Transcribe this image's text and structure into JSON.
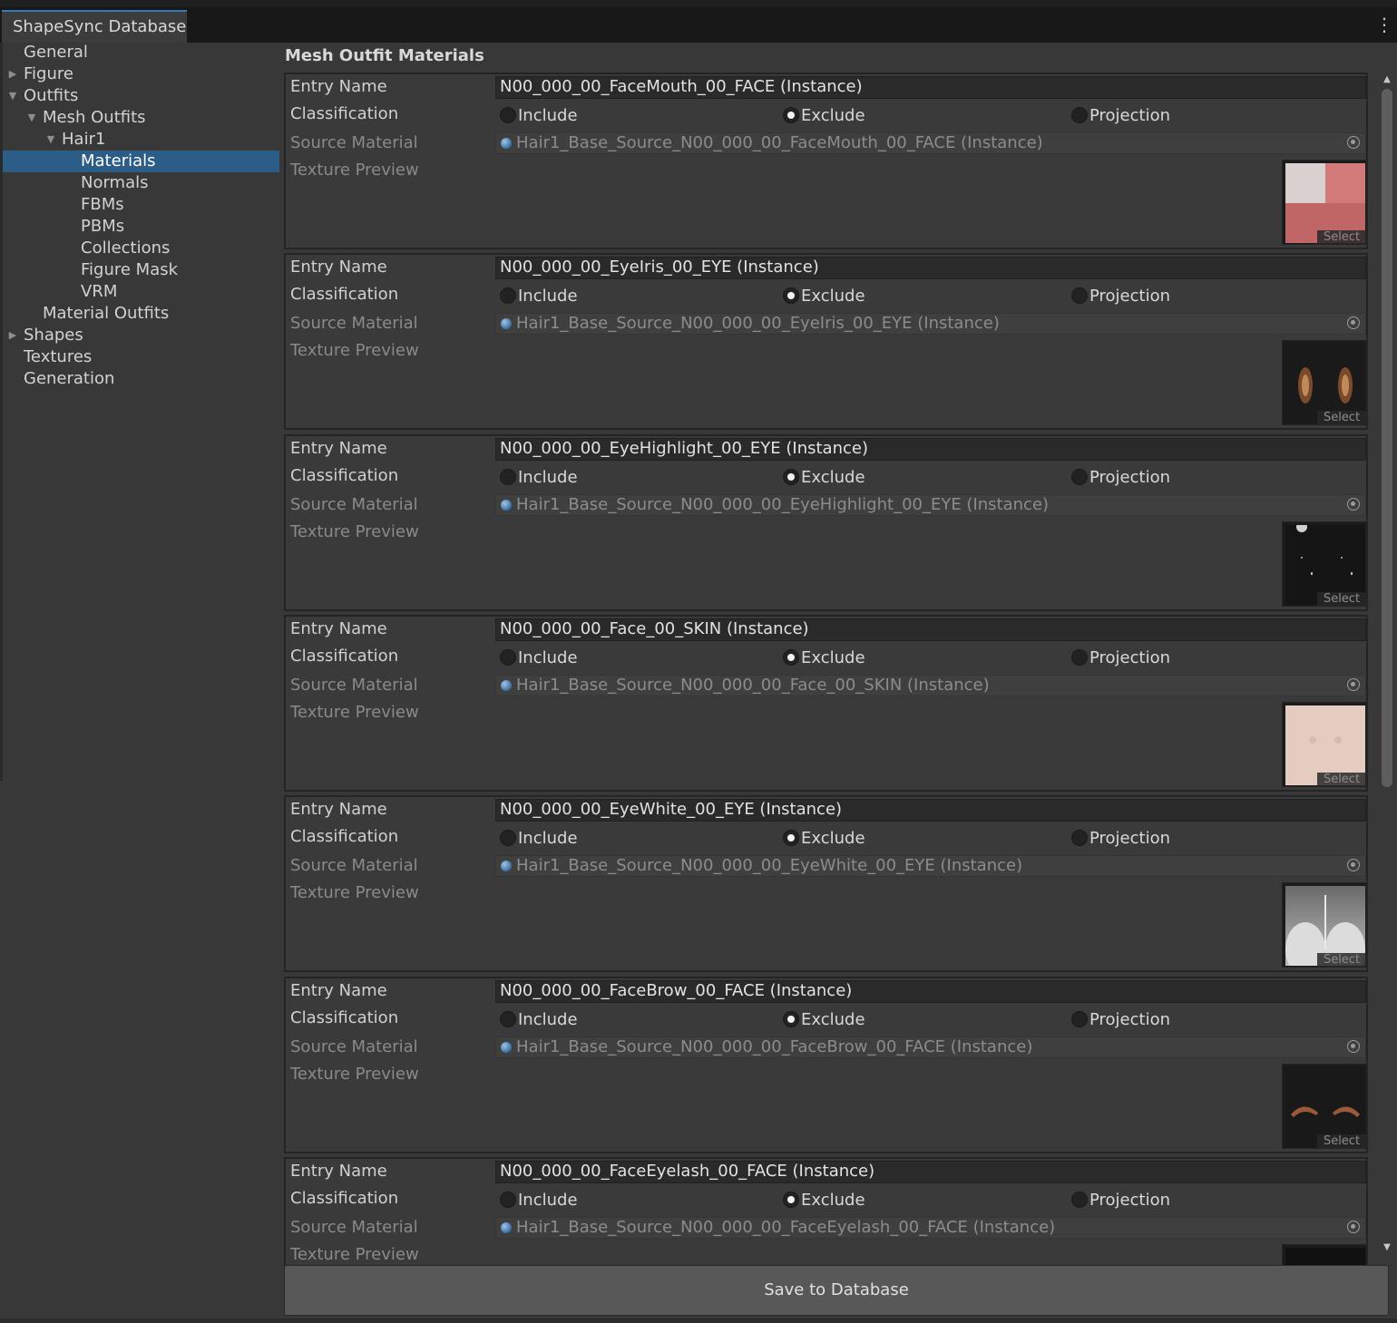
{
  "window": {
    "tab_title": "ShapeSync Database",
    "menu_glyph": "⋮"
  },
  "sidebar": {
    "items": [
      {
        "label": "General",
        "level": 0,
        "arrow": ""
      },
      {
        "label": "Figure",
        "level": 0,
        "arrow": "right"
      },
      {
        "label": "Outfits",
        "level": 0,
        "arrow": "down"
      },
      {
        "label": "Mesh Outfits",
        "level": 1,
        "arrow": "down"
      },
      {
        "label": "Hair1",
        "level": 2,
        "arrow": "down"
      },
      {
        "label": "Materials",
        "level": 3,
        "arrow": "",
        "selected": true
      },
      {
        "label": "Normals",
        "level": 3,
        "arrow": ""
      },
      {
        "label": "FBMs",
        "level": 3,
        "arrow": ""
      },
      {
        "label": "PBMs",
        "level": 3,
        "arrow": ""
      },
      {
        "label": "Collections",
        "level": 3,
        "arrow": ""
      },
      {
        "label": "Figure Mask",
        "level": 3,
        "arrow": ""
      },
      {
        "label": "VRM",
        "level": 3,
        "arrow": ""
      },
      {
        "label": "Material Outfits",
        "level": 1,
        "arrow": ""
      },
      {
        "label": "Shapes",
        "level": 0,
        "arrow": "right"
      },
      {
        "label": "Textures",
        "level": 0,
        "arrow": ""
      },
      {
        "label": "Generation",
        "level": 0,
        "arrow": ""
      }
    ]
  },
  "main": {
    "section_title": "Mesh Outfit Materials",
    "labels": {
      "entry_name": "Entry Name",
      "classification": "Classification",
      "source_material": "Source Material",
      "texture_preview": "Texture Preview",
      "select": "Select"
    },
    "options": [
      "Include",
      "Exclude",
      "Projection"
    ],
    "entries": [
      {
        "name": "N00_000_00_FaceMouth_00_FACE (Instance)",
        "classification": "Exclude",
        "source": "Hair1_Base_Source_N00_000_00_FaceMouth_00_FACE (Instance)",
        "preview": "facemouth-texture"
      },
      {
        "name": "N00_000_00_EyeIris_00_EYE (Instance)",
        "classification": "Exclude",
        "source": "Hair1_Base_Source_N00_000_00_EyeIris_00_EYE (Instance)",
        "preview": "eyeiris-texture"
      },
      {
        "name": "N00_000_00_EyeHighlight_00_EYE (Instance)",
        "classification": "Exclude",
        "source": "Hair1_Base_Source_N00_000_00_EyeHighlight_00_EYE (Instance)",
        "preview": "eyehighlight-texture"
      },
      {
        "name": "N00_000_00_Face_00_SKIN (Instance)",
        "classification": "Exclude",
        "source": "Hair1_Base_Source_N00_000_00_Face_00_SKIN (Instance)",
        "preview": "face-skin-texture"
      },
      {
        "name": "N00_000_00_EyeWhite_00_EYE (Instance)",
        "classification": "Exclude",
        "source": "Hair1_Base_Source_N00_000_00_EyeWhite_00_EYE (Instance)",
        "preview": "eyewhite-texture"
      },
      {
        "name": "N00_000_00_FaceBrow_00_FACE (Instance)",
        "classification": "Exclude",
        "source": "Hair1_Base_Source_N00_000_00_FaceBrow_00_FACE (Instance)",
        "preview": "facebrow-texture"
      },
      {
        "name": "N00_000_00_FaceEyelash_00_FACE (Instance)",
        "classification": "Exclude",
        "source": "Hair1_Base_Source_N00_000_00_FaceEyelash_00_FACE (Instance)",
        "preview": "faceeyelash-texture"
      }
    ],
    "save_button": "Save to Database"
  },
  "colors": {
    "accent": "#2c5d87",
    "tab_accent": "#3a79bb"
  }
}
